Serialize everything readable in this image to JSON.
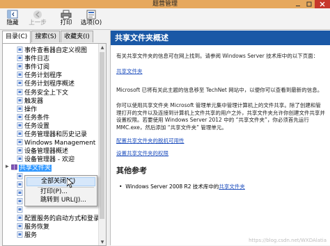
{
  "window": {
    "title": "题营管理"
  },
  "toolbar": {
    "buttons": [
      {
        "label": "隐藏"
      },
      {
        "label": "上一步"
      },
      {
        "label": "打印"
      },
      {
        "label": "选项(O)"
      }
    ]
  },
  "left": {
    "tabs": [
      "目录(C)",
      "搜索(S)",
      "收藏夹(I)"
    ],
    "tree": [
      "事件查看器自定义视图",
      "事件日志",
      "事件订阅",
      "任务计划程序",
      "任务计划程序概述",
      "任务安全上下文",
      "触发器",
      "操作",
      "任务条件",
      "任务设置",
      "任务管理器和历史记录",
      "Windows Management Instru",
      "设备管理器概述",
      "设备管理器 - 欢迎",
      "共享文件夹",
      "",
      "",
      "",
      "",
      "",
      "配置服务的启动方式和登录选项",
      "服务恢复",
      "服务"
    ],
    "selected_index": 14
  },
  "context_menu": {
    "items": [
      "全部关闭(C)",
      "打印(P)...",
      "跳转到 URL(J)..."
    ]
  },
  "right": {
    "header": "共享文件夹概述",
    "intro": "有关共享文件夹的信息可在网上找到。请参阅 Windows Server 技术库中的以下页面：",
    "link1": "共享文件夹",
    "para1": "Microsoft 已将有关此主题的信息移至 TechNet 网站中，以便你可以查看到最新的信息。",
    "para2": "你可以使用共享文件夹 Microsoft 管理单元集中管理计算机上的文件共享。除了创建和管理打开的文件以及连接到计算机上文件共享的用户之外，共享文件夹允许你创建文件共享并设置权限。若要使用 Windows Server 2012 中的 “共享文件夹”，你必须首先运行 MMC.exe，然后添加 “共享文件夹” 管理单元。",
    "link2": "配置共享文件夹的脱机可用性",
    "link3": "设置共享文件夹的权限",
    "section2": "其他参考",
    "bullet_prefix": "Windows Server 2008 R2 技术库中的",
    "bullet_link": "共享文件夹"
  },
  "watermark": "https://blog.csdn.net/WXDAlatia"
}
